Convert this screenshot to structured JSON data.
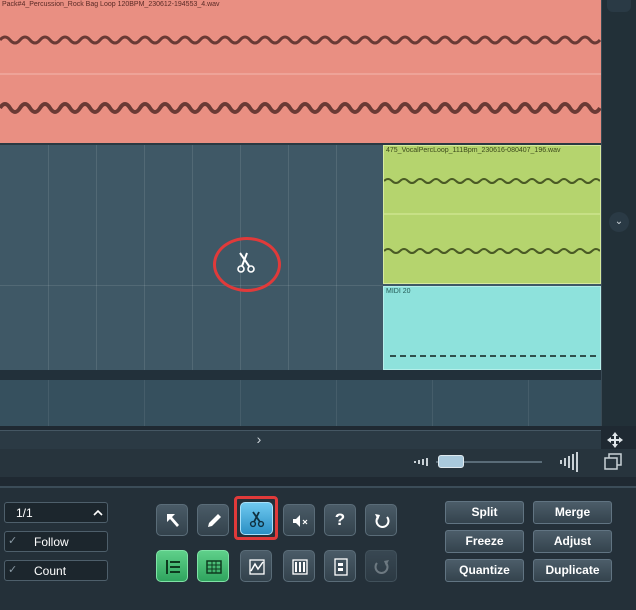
{
  "tracks": [
    {
      "clip_title": "Pack#4_Percussion_Rock Bag Loop 120BPM_230612-194553_4.wav",
      "color": "#e98f82"
    },
    {
      "clip_title": "475_VocalPercLoop_111Bpm_230616-080407_196.wav",
      "color": "#b5d46e"
    },
    {
      "clip_title": "MIDI 20",
      "color": "#8ee2dc"
    }
  ],
  "cursor": {
    "icon": "scissors-icon",
    "highlight_color": "#e03a3a"
  },
  "scrollbar": {
    "down_arrow": "⌄",
    "right_arrow": "›"
  },
  "panel": {
    "quantize_value": "1/1",
    "follow_label": "Follow",
    "count_label": "Count",
    "tools_row1": [
      "arrow-tool",
      "pencil-tool",
      "split-tool",
      "mute-tool",
      "help-tool",
      "undo-tool"
    ],
    "help_glyph": "?",
    "tools_row2": [
      "list-editor",
      "table-editor",
      "curve-editor",
      "drum-editor",
      "score-editor",
      "redo-tool"
    ],
    "buttons": {
      "split": "Split",
      "merge": "Merge",
      "freeze": "Freeze",
      "adjust": "Adjust",
      "quantize": "Quantize",
      "duplicate": "Duplicate"
    }
  }
}
